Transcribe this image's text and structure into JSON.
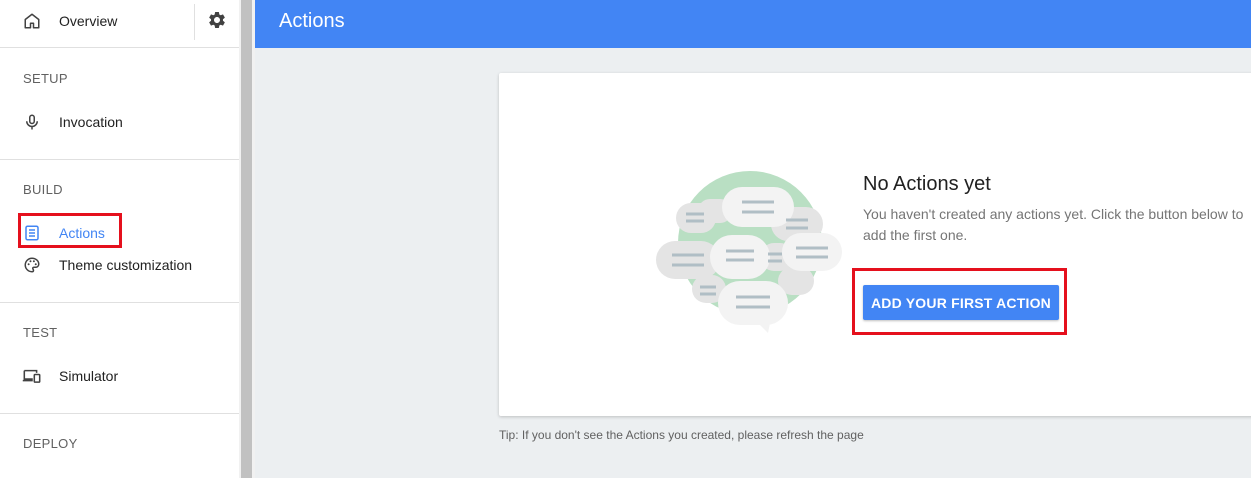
{
  "sidebar": {
    "overview_label": "Overview",
    "sections": {
      "setup": "SETUP",
      "build": "BUILD",
      "test": "TEST",
      "deploy": "DEPLOY"
    },
    "items": {
      "invocation": "Invocation",
      "actions": "Actions",
      "theme": "Theme customization",
      "simulator": "Simulator"
    },
    "active_item": "Actions",
    "icons": {
      "overview": "home-icon",
      "settings": "gear-icon",
      "invocation": "microphone-icon",
      "actions": "list-icon",
      "theme": "palette-icon",
      "simulator": "devices-icon"
    }
  },
  "header": {
    "title": "Actions"
  },
  "empty_state": {
    "title": "No Actions yet",
    "description": "You haven't created any actions yet. Click the button below to add the first one.",
    "button_label": "ADD YOUR FIRST ACTION",
    "illustration": "chat-bubbles-illustration"
  },
  "tip": "Tip: If you don't see the Actions you created, please refresh the page",
  "colors": {
    "accent": "#4285f4",
    "highlight": "#e5101d",
    "background": "#eceff1"
  }
}
